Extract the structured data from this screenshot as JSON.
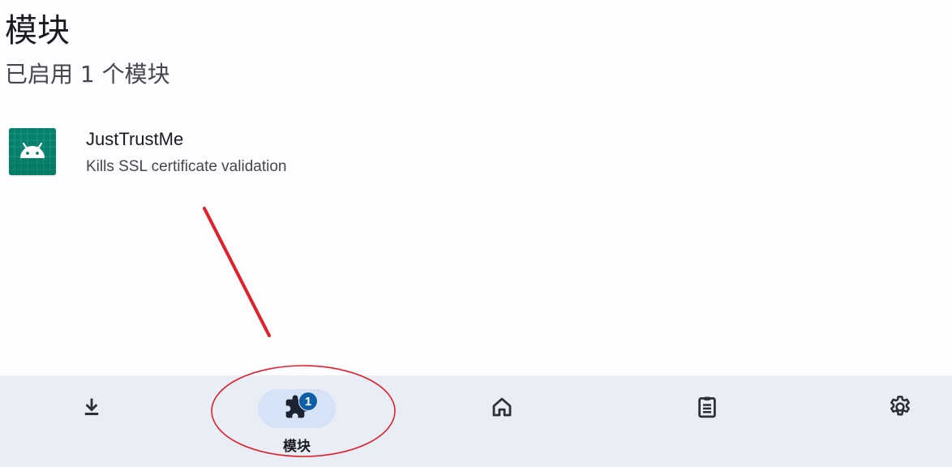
{
  "page": {
    "title": "模块",
    "subtitle": "已启用 1 个模块"
  },
  "modules": [
    {
      "name": "JustTrustMe",
      "description": "Kills SSL certificate validation",
      "icon": "android-icon",
      "icon_color": "#07806b"
    }
  ],
  "bottom_nav": {
    "items": [
      {
        "id": "repository",
        "icon": "download-icon",
        "label": ""
      },
      {
        "id": "modules",
        "icon": "puzzle-icon",
        "label": "模块",
        "badge": "1",
        "active": true
      },
      {
        "id": "home",
        "icon": "home-icon",
        "label": ""
      },
      {
        "id": "logs",
        "icon": "clipboard-icon",
        "label": ""
      },
      {
        "id": "settings",
        "icon": "gear-icon",
        "label": ""
      }
    ],
    "background": "#e8edf6",
    "active_indicator": "#d6e2f5",
    "badge_color": "#0f5fa8"
  },
  "annotation_color": "#e0202a"
}
